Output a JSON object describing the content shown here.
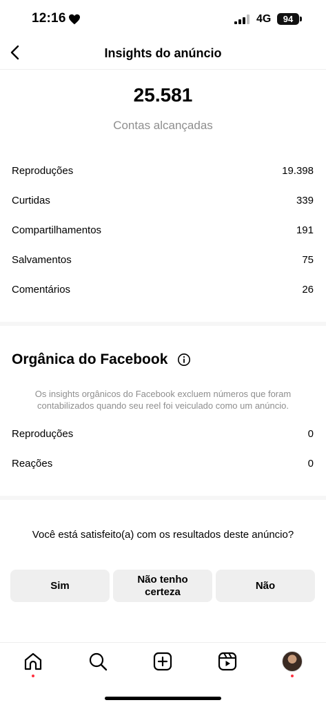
{
  "status_bar": {
    "time": "12:16",
    "network": "4G",
    "battery": "94"
  },
  "header": {
    "title": "Insights do anúncio"
  },
  "summary": {
    "value": "25.581",
    "label": "Contas alcançadas"
  },
  "metrics": [
    {
      "label": "Reproduções",
      "value": "19.398"
    },
    {
      "label": "Curtidas",
      "value": "339"
    },
    {
      "label": "Compartilhamentos",
      "value": "191"
    },
    {
      "label": "Salvamentos",
      "value": "75"
    },
    {
      "label": "Comentários",
      "value": "26"
    }
  ],
  "facebook": {
    "title": "Orgânica do Facebook",
    "note": "Os insights orgânicos do Facebook excluem números que foram contabilizados quando seu reel foi veiculado como um anúncio.",
    "metrics": [
      {
        "label": "Reproduções",
        "value": "0"
      },
      {
        "label": "Reações",
        "value": "0"
      }
    ]
  },
  "feedback": {
    "question": "Você está satisfeito(a) com os resultados deste anúncio?",
    "yes": "Sim",
    "unsure": "Não tenho certeza",
    "no": "Não"
  },
  "tab_bar": {
    "items": [
      "home-icon",
      "search-icon",
      "create-icon",
      "reels-icon",
      "profile-avatar"
    ],
    "notification_color": "#ff3040"
  }
}
